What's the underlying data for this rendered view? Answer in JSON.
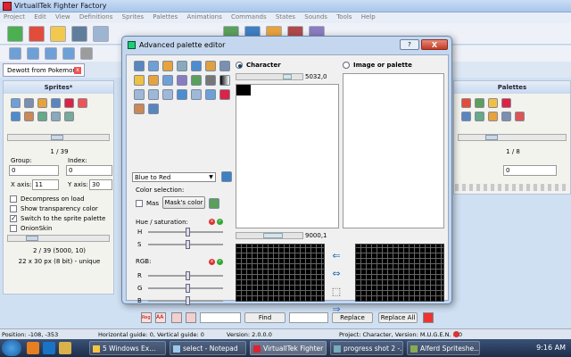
{
  "app": {
    "title": "VirtuallTek Fighter Factory"
  },
  "menu": [
    "Project",
    "Edit",
    "View",
    "Definitions",
    "Sprites",
    "Palettes",
    "Animations",
    "Commands",
    "States",
    "Sounds",
    "Tools",
    "Help"
  ],
  "document_tab": {
    "label": "Dewott from Pokemon"
  },
  "sprites_panel": {
    "title": "Sprites*",
    "counter": "1 / 39",
    "group_label": "Group:",
    "group_value": "0",
    "index_label": "Index:",
    "index_value": "0",
    "xaxis_label": "X axis:",
    "xaxis_value": "11",
    "yaxis_label": "Y axis:",
    "yaxis_value": "30",
    "decompress": "Decompress on load",
    "show_transparency": "Show transparency color",
    "switch_palette": "Switch to the sprite palette",
    "onionskin": "OnionSkin",
    "info_line1": "2 / 39 (5000, 10)",
    "info_line2": "22 x 30 px (8 bit) - unique"
  },
  "palettes_panel": {
    "title": "Palettes",
    "counter": "1 / 8",
    "value": "0"
  },
  "dialog": {
    "title": "Advanced palette editor",
    "help_btn": "?",
    "close_btn": "X",
    "character_label": "Character",
    "image_label": "Image or palette",
    "char_zoom": "5032,0",
    "char_zoom2": "9000,1",
    "gradient_select": "Blue to Red",
    "color_selection": "Color selection:",
    "mas_label": "Mas",
    "mask_button": "Mask's color",
    "hue_sat": "Hue / saturation:",
    "h": "H",
    "s": "S",
    "rgb": "RGB:",
    "r": "R",
    "g": "G",
    "b": "B"
  },
  "findbar": {
    "reg": "Reg",
    "aa": "AA",
    "find": "Find",
    "replace": "Replace",
    "replace_all": "Replace All"
  },
  "status": {
    "position": "Position: -108, -353",
    "guides": "Horizontal guide: 0, Vertical guide: 0",
    "version": "Version: 2.0.0.0",
    "project": "Project: Character, Version: M.U.G.E.N. 1.0"
  },
  "taskbar": {
    "items": [
      "5 Windows Ex...",
      "select - Notepad",
      "VirtuallTek Fighter ...",
      "progress shot 2 -...",
      "Alferd Spriteshe..."
    ],
    "clock": "9:16 AM"
  },
  "colors": {
    "accent": "#2b6fb8",
    "close_red": "#c33a23",
    "panel_head": "#c8d9ef"
  }
}
